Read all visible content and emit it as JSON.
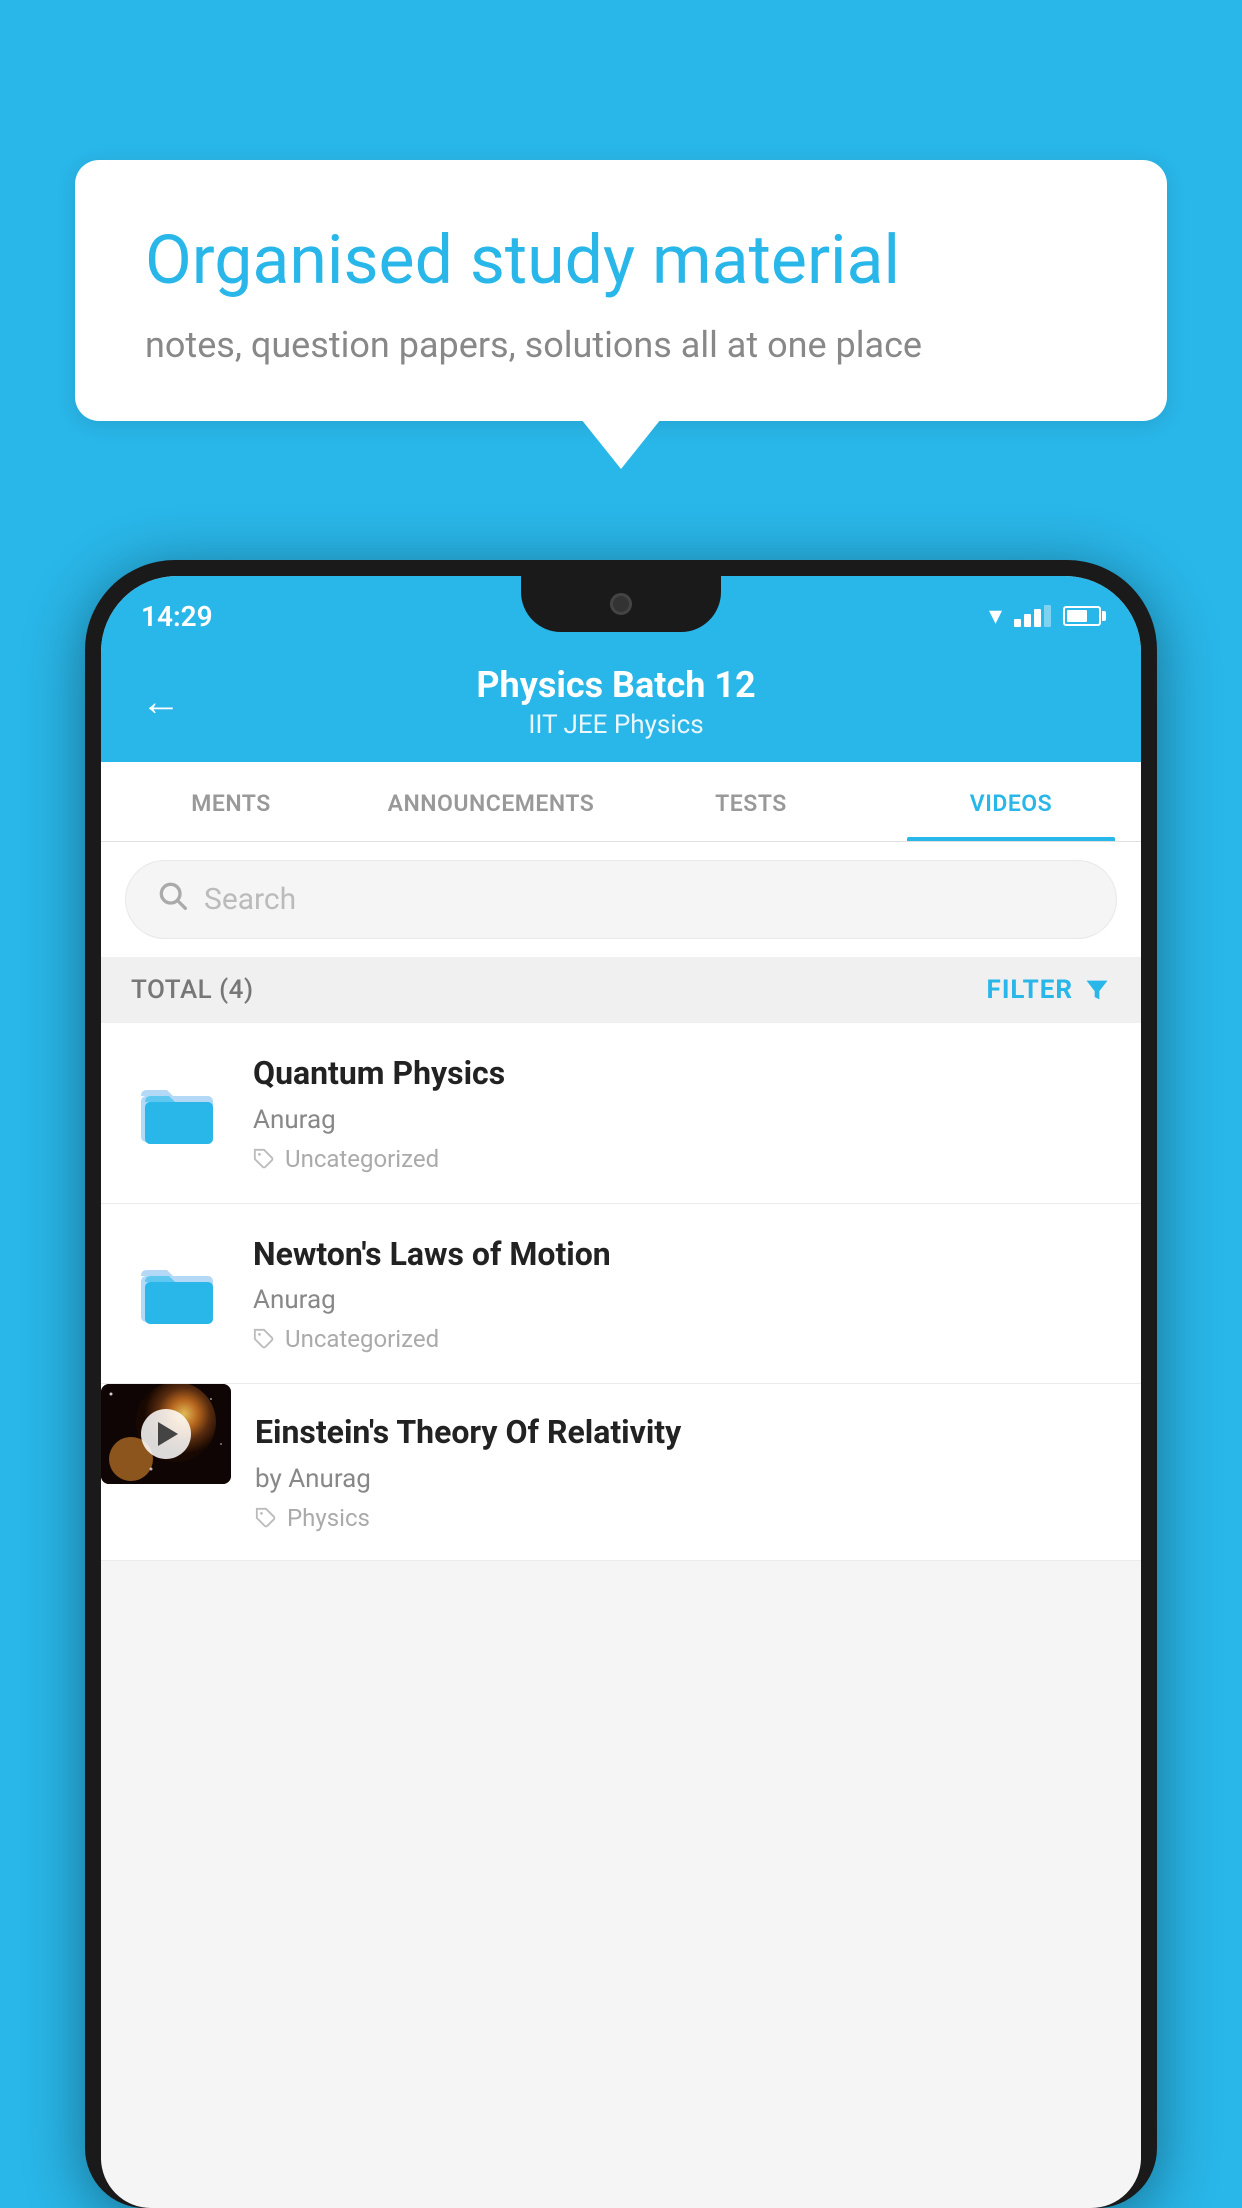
{
  "background_color": "#29b6e8",
  "bubble": {
    "title": "Organised study material",
    "subtitle": "notes, question papers, solutions all at one place"
  },
  "status_bar": {
    "time": "14:29",
    "wifi": "▼",
    "battery_level": 65
  },
  "app_header": {
    "back_label": "←",
    "title": "Physics Batch 12",
    "subtitle": "IIT JEE   Physics"
  },
  "tabs": [
    {
      "label": "MENTS",
      "active": false
    },
    {
      "label": "ANNOUNCEMENTS",
      "active": false
    },
    {
      "label": "TESTS",
      "active": false
    },
    {
      "label": "VIDEOS",
      "active": true
    }
  ],
  "search": {
    "placeholder": "Search"
  },
  "filter_bar": {
    "total_label": "TOTAL (4)",
    "filter_label": "FILTER"
  },
  "videos": [
    {
      "id": 1,
      "title": "Quantum Physics",
      "author": "Anurag",
      "tag": "Uncategorized",
      "has_thumb": false
    },
    {
      "id": 2,
      "title": "Newton's Laws of Motion",
      "author": "Anurag",
      "tag": "Uncategorized",
      "has_thumb": false
    },
    {
      "id": 3,
      "title": "Einstein's Theory Of Relativity",
      "author": "by Anurag",
      "tag": "Physics",
      "has_thumb": true
    }
  ]
}
